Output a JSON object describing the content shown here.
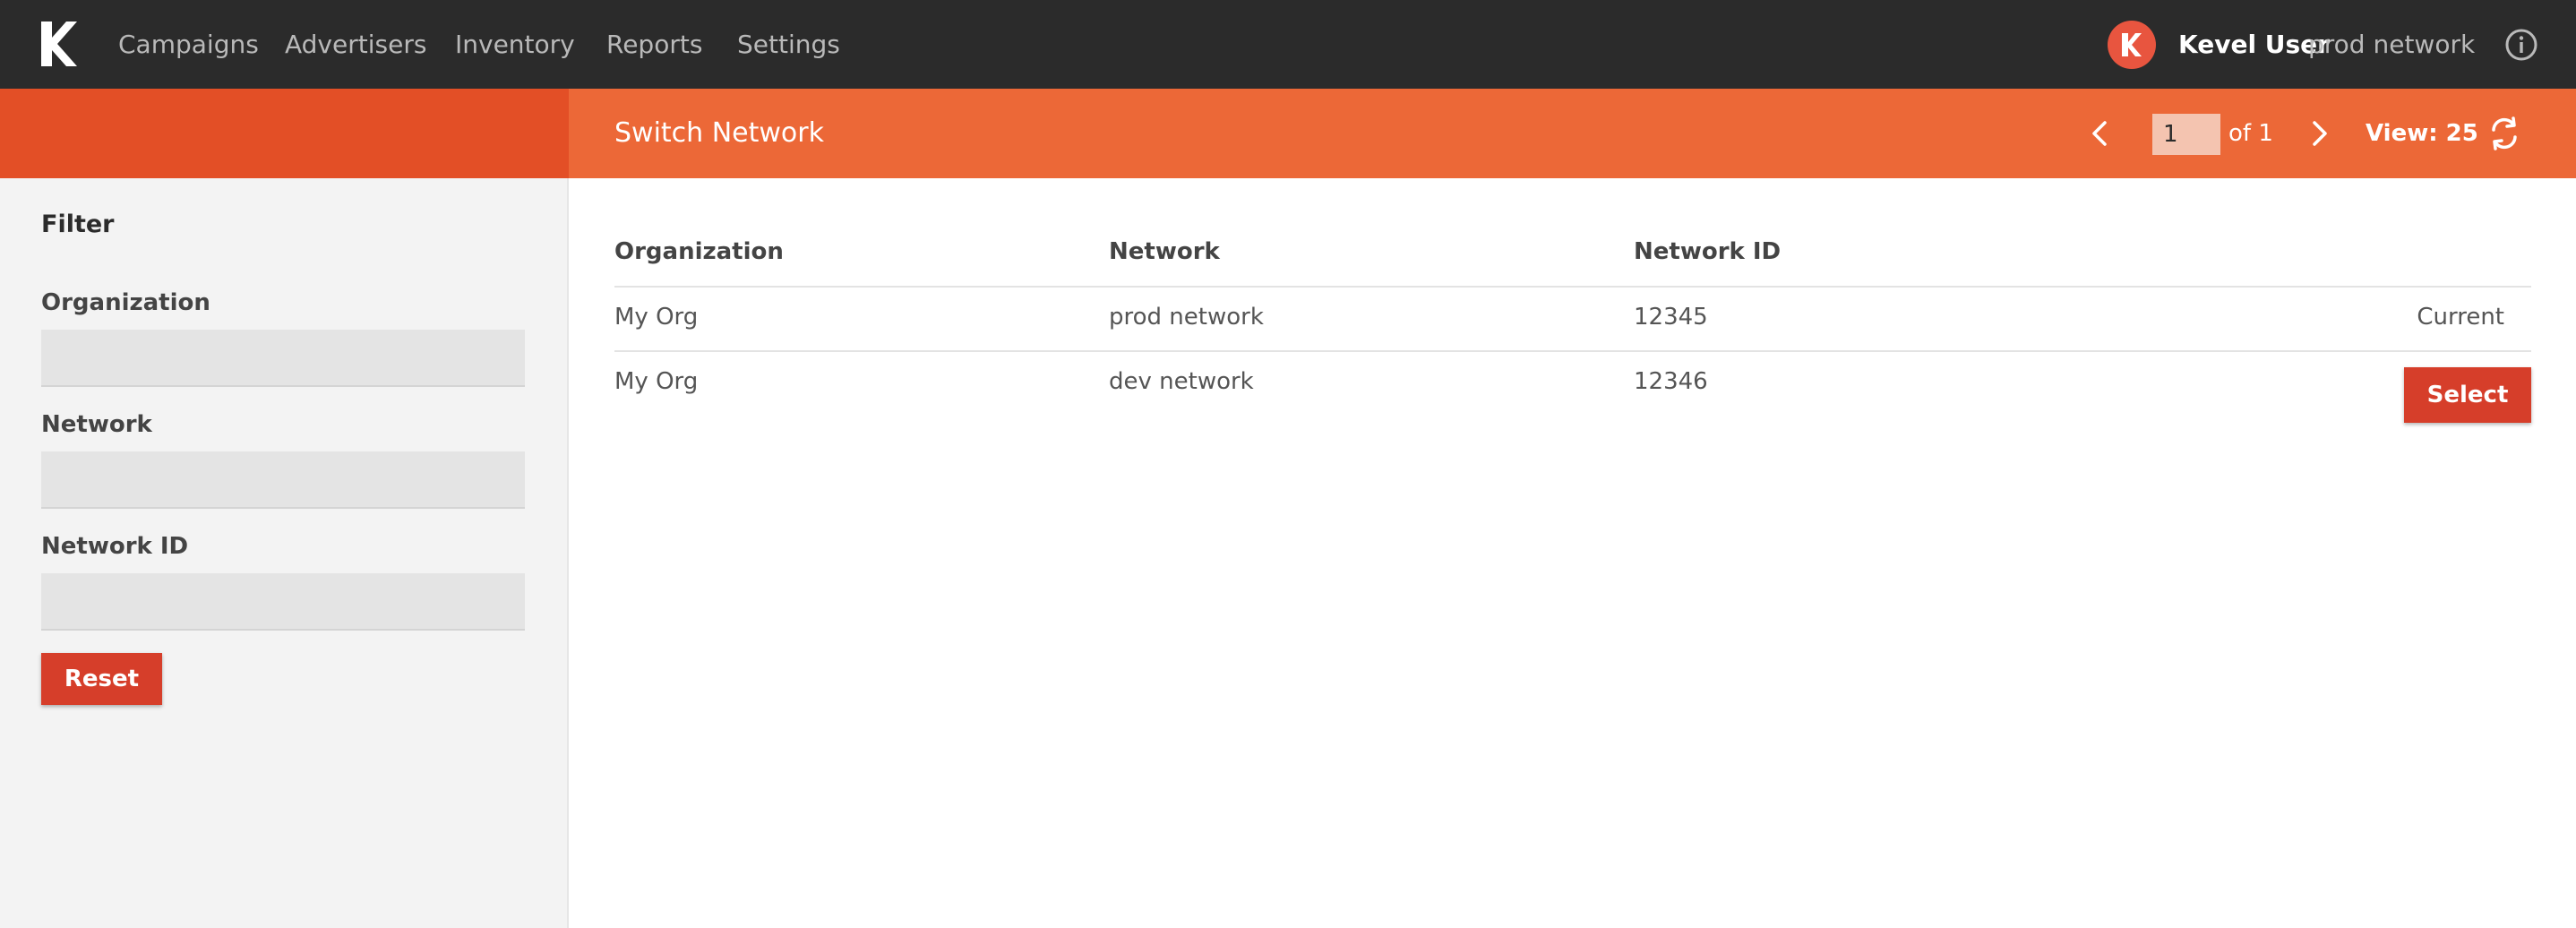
{
  "nav": {
    "logo_icon": "kevel-logo-icon",
    "items": [
      {
        "label": "Campaigns"
      },
      {
        "label": "Advertisers"
      },
      {
        "label": "Inventory"
      },
      {
        "label": "Reports"
      },
      {
        "label": "Settings"
      }
    ],
    "user": {
      "avatar_icon": "kevel-avatar-icon",
      "name": "Kevel User",
      "network": "prod network"
    },
    "info_icon": "info-icon"
  },
  "header": {
    "title": "Switch Network",
    "pager": {
      "prev_icon": "chevron-left-icon",
      "page_value": "1",
      "of_text": "of 1",
      "next_icon": "chevron-right-icon",
      "view_label": "View: 25",
      "refresh_icon": "refresh-icon"
    }
  },
  "sidebar": {
    "title": "Filter",
    "fields": [
      {
        "label": "Organization",
        "value": "",
        "placeholder": ""
      },
      {
        "label": "Network",
        "value": "",
        "placeholder": ""
      },
      {
        "label": "Network ID",
        "value": "",
        "placeholder": ""
      }
    ],
    "reset_label": "Reset"
  },
  "table": {
    "columns": [
      "Organization",
      "Network",
      "Network ID"
    ],
    "rows": [
      {
        "organization": "My Org",
        "network": "prod network",
        "network_id": "12345",
        "status": "Current"
      },
      {
        "organization": "My Org",
        "network": "dev network",
        "network_id": "12346",
        "action_label": "Select"
      }
    ]
  },
  "colors": {
    "topbar": "#2b2b2b",
    "band_left": "#e34f26",
    "band_right": "#ec6837",
    "button": "#d63e2a",
    "sidebar": "#f3f3f3"
  }
}
